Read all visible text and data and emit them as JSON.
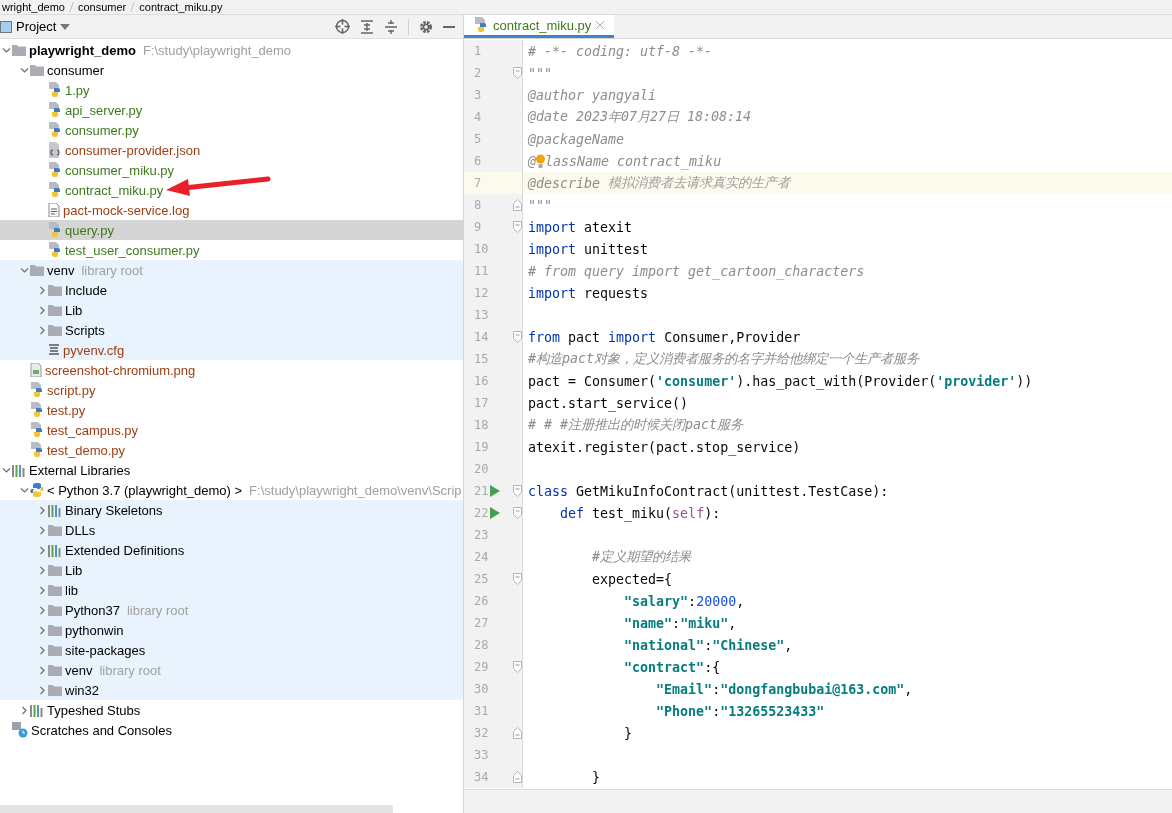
{
  "breadcrumb": [
    "wright_demo",
    "consumer",
    "contract_miku.py"
  ],
  "project_panel": {
    "title": "Project",
    "tree": [
      {
        "label": "playwright_demo",
        "hint": "F:\\study\\playwright_demo",
        "kind": "folder",
        "color": "#000000",
        "bold": true,
        "library": false,
        "selected": false,
        "expanded": true,
        "children": [
          {
            "label": "consumer",
            "kind": "folder",
            "color": "#000000",
            "library": false,
            "selected": false,
            "expanded": true,
            "children": [
              {
                "label": "1.py",
                "kind": "python-file",
                "color": "#3d7a1c",
                "library": false,
                "selected": false
              },
              {
                "label": "api_server.py",
                "kind": "python-file",
                "color": "#3d7a1c",
                "library": false,
                "selected": false
              },
              {
                "label": "consumer.py",
                "kind": "python-file",
                "color": "#3d7a1c",
                "library": false,
                "selected": false
              },
              {
                "label": "consumer-provider.json",
                "kind": "json-file",
                "color": "#9c3d12",
                "library": false,
                "selected": false
              },
              {
                "label": "consumer_miku.py",
                "kind": "python-file",
                "color": "#3d7a1c",
                "library": false,
                "selected": false
              },
              {
                "label": "contract_miku.py",
                "kind": "python-file",
                "color": "#3d7a1c",
                "library": false,
                "selected": false
              },
              {
                "label": "pact-mock-service.log",
                "kind": "text-file",
                "color": "#9c3d12",
                "library": false,
                "selected": false
              },
              {
                "label": "query.py",
                "kind": "python-file",
                "color": "#3d7a1c",
                "library": false,
                "selected": true
              },
              {
                "label": "test_user_consumer.py",
                "kind": "python-file",
                "color": "#3d7a1c",
                "library": false,
                "selected": false
              }
            ]
          },
          {
            "label": "venv",
            "hint": "library root",
            "kind": "folder",
            "color": "#000000",
            "library": true,
            "selected": false,
            "expanded": true,
            "children": [
              {
                "label": "Include",
                "kind": "folder",
                "color": "#000000",
                "library": true,
                "selected": false,
                "expanded": false
              },
              {
                "label": "Lib",
                "kind": "folder",
                "color": "#000000",
                "library": true,
                "selected": false,
                "expanded": false
              },
              {
                "label": "Scripts",
                "kind": "folder",
                "color": "#000000",
                "library": true,
                "selected": false,
                "expanded": false
              },
              {
                "label": "pyvenv.cfg",
                "kind": "config-file",
                "color": "#9c3d12",
                "library": true,
                "selected": false
              }
            ]
          },
          {
            "label": "screenshot-chromium.png",
            "kind": "image-file",
            "color": "#9c3d12",
            "library": false,
            "selected": false
          },
          {
            "label": "script.py",
            "kind": "python-file",
            "color": "#9c3d12",
            "library": false,
            "selected": false
          },
          {
            "label": "test.py",
            "kind": "python-file",
            "color": "#9c3d12",
            "library": false,
            "selected": false
          },
          {
            "label": "test_campus.py",
            "kind": "python-file",
            "color": "#9c3d12",
            "library": false,
            "selected": false
          },
          {
            "label": "test_demo.py",
            "kind": "python-file",
            "color": "#9c3d12",
            "library": false,
            "selected": false
          }
        ]
      },
      {
        "label": "External Libraries",
        "kind": "library",
        "color": "#000000",
        "library": false,
        "selected": false,
        "expanded": true,
        "children": [
          {
            "label": "< Python 3.7 (playwright_demo) >",
            "hint": "F:\\study\\playwright_demo\\venv\\Scrip",
            "kind": "python-sdk",
            "color": "#000000",
            "library": false,
            "selected": false,
            "expanded": true,
            "children": [
              {
                "label": "Binary Skeletons",
                "kind": "library",
                "color": "#000000",
                "library": true,
                "selected": false,
                "expanded": false
              },
              {
                "label": "DLLs",
                "kind": "folder",
                "color": "#000000",
                "library": true,
                "selected": false,
                "expanded": false
              },
              {
                "label": "Extended Definitions",
                "kind": "library",
                "color": "#000000",
                "library": true,
                "selected": false,
                "expanded": false
              },
              {
                "label": "Lib",
                "kind": "folder",
                "color": "#000000",
                "library": true,
                "selected": false,
                "expanded": false
              },
              {
                "label": "lib",
                "kind": "folder",
                "color": "#000000",
                "library": true,
                "selected": false,
                "expanded": false
              },
              {
                "label": "Python37",
                "hint": "library root",
                "kind": "folder",
                "color": "#000000",
                "library": true,
                "selected": false,
                "expanded": false
              },
              {
                "label": "pythonwin",
                "kind": "folder",
                "color": "#000000",
                "library": true,
                "selected": false,
                "expanded": false
              },
              {
                "label": "site-packages",
                "kind": "folder",
                "color": "#000000",
                "library": true,
                "selected": false,
                "expanded": false
              },
              {
                "label": "venv",
                "hint": "library root",
                "kind": "folder",
                "color": "#000000",
                "library": true,
                "selected": false,
                "expanded": false
              },
              {
                "label": "win32",
                "kind": "folder",
                "color": "#000000",
                "library": true,
                "selected": false,
                "expanded": false
              }
            ]
          },
          {
            "label": "Typeshed Stubs",
            "kind": "library",
            "color": "#000000",
            "library": false,
            "selected": false,
            "expanded": false
          }
        ]
      },
      {
        "label": "Scratches and Consoles",
        "kind": "scratches",
        "color": "#000000",
        "library": false,
        "selected": false
      }
    ]
  },
  "editor": {
    "tabs": [
      {
        "label": "contract_miku.py",
        "selected": true
      }
    ],
    "lines": [
      {
        "number": "1",
        "tokens": [
          {
            "kind": "comment",
            "text": "# -*- coding: utf-8 -*-"
          }
        ]
      },
      {
        "number": "2",
        "fold_start": true,
        "tokens": [
          {
            "kind": "doc",
            "text": "\"\"\""
          }
        ]
      },
      {
        "number": "3",
        "tokens": [
          {
            "kind": "doc",
            "text": "@author yangyali"
          }
        ]
      },
      {
        "number": "4",
        "tokens": [
          {
            "kind": "doc",
            "text": "@date 2023年07月27日 18:08:14"
          }
        ]
      },
      {
        "number": "5",
        "tokens": [
          {
            "kind": "doc",
            "text": "@packageName"
          }
        ]
      },
      {
        "number": "6",
        "tokens": [
          {
            "kind": "doc",
            "text": "@"
          },
          {
            "kind": "bulb"
          },
          {
            "kind": "doc",
            "text": "lassName contract_miku"
          }
        ]
      },
      {
        "number": "7",
        "current": true,
        "tokens": [
          {
            "kind": "doc",
            "text": "@describe "
          },
          {
            "kind": "doc-note",
            "text": "模拟消费者去请求真实的生产者"
          }
        ]
      },
      {
        "number": "8",
        "fold_end": true,
        "tokens": [
          {
            "kind": "doc",
            "text": "\"\"\""
          }
        ]
      },
      {
        "number": "9",
        "fold_start": true,
        "tokens": [
          {
            "kind": "keyword",
            "text": "import"
          },
          {
            "kind": "plain",
            "text": " atexit"
          }
        ]
      },
      {
        "number": "10",
        "tokens": [
          {
            "kind": "keyword",
            "text": "import"
          },
          {
            "kind": "plain",
            "text": " unittest"
          }
        ]
      },
      {
        "number": "11",
        "tokens": [
          {
            "kind": "comment",
            "text": "# from query import get_cartoon_characters"
          }
        ]
      },
      {
        "number": "12",
        "tokens": [
          {
            "kind": "keyword",
            "text": "import"
          },
          {
            "kind": "plain",
            "text": " requests"
          }
        ]
      },
      {
        "number": "13"
      },
      {
        "number": "14",
        "fold_start": true,
        "tokens": [
          {
            "kind": "keyword",
            "text": "from"
          },
          {
            "kind": "plain",
            "text": " pact "
          },
          {
            "kind": "keyword",
            "text": "import"
          },
          {
            "kind": "plain",
            "text": " Consumer,Provider"
          }
        ]
      },
      {
        "number": "15",
        "tokens": [
          {
            "kind": "comment",
            "text": "#构造pact对象，定义消费者服务的名字并给他绑定一个生产者服务"
          }
        ]
      },
      {
        "number": "16",
        "tokens": [
          {
            "kind": "plain",
            "text": "pact = Consumer("
          },
          {
            "kind": "string",
            "text": "'consumer'"
          },
          {
            "kind": "plain",
            "text": ").has_pact_with(Provider("
          },
          {
            "kind": "string",
            "text": "'provider'"
          },
          {
            "kind": "plain",
            "text": "))"
          }
        ]
      },
      {
        "number": "17",
        "tokens": [
          {
            "kind": "plain",
            "text": "pact.start_service()"
          }
        ]
      },
      {
        "number": "18",
        "tokens": [
          {
            "kind": "comment",
            "text": "# # #注册推出的时候关闭pact服务"
          }
        ]
      },
      {
        "number": "19",
        "tokens": [
          {
            "kind": "plain",
            "text": "atexit.register(pact.stop_service)"
          }
        ]
      },
      {
        "number": "20"
      },
      {
        "number": "21",
        "run": true,
        "fold_start": true,
        "tokens": [
          {
            "kind": "keyword",
            "text": "class"
          },
          {
            "kind": "plain",
            "text": " GetMikuInfoContract(unittest.TestCase):"
          }
        ]
      },
      {
        "number": "22",
        "run": true,
        "fold_start": true,
        "tokens": [
          {
            "kind": "keyword",
            "text": "    def"
          },
          {
            "kind": "plain",
            "text": " test_miku("
          },
          {
            "kind": "self",
            "text": "self"
          },
          {
            "kind": "plain",
            "text": "):"
          }
        ]
      },
      {
        "number": "23"
      },
      {
        "number": "24",
        "tokens": [
          {
            "kind": "comment",
            "text": "        #定义期望的结果"
          }
        ]
      },
      {
        "number": "25",
        "fold_start": true,
        "tokens": [
          {
            "kind": "plain",
            "text": "        expected={"
          }
        ]
      },
      {
        "number": "26",
        "tokens": [
          {
            "kind": "string",
            "text": "            \"salary\""
          },
          {
            "kind": "plain",
            "text": ":"
          },
          {
            "kind": "number",
            "text": "20000"
          },
          {
            "kind": "plain",
            "text": ","
          }
        ]
      },
      {
        "number": "27",
        "tokens": [
          {
            "kind": "string",
            "text": "            \"name\""
          },
          {
            "kind": "plain",
            "text": ":"
          },
          {
            "kind": "string",
            "text": "\"miku\""
          },
          {
            "kind": "plain",
            "text": ","
          }
        ]
      },
      {
        "number": "28",
        "tokens": [
          {
            "kind": "string",
            "text": "            \"national\""
          },
          {
            "kind": "plain",
            "text": ":"
          },
          {
            "kind": "string",
            "text": "\"Chinese\""
          },
          {
            "kind": "plain",
            "text": ","
          }
        ]
      },
      {
        "number": "29",
        "fold_start": true,
        "tokens": [
          {
            "kind": "string",
            "text": "            \"contract\""
          },
          {
            "kind": "plain",
            "text": ":{"
          }
        ]
      },
      {
        "number": "30",
        "tokens": [
          {
            "kind": "string",
            "text": "                \"Email\""
          },
          {
            "kind": "plain",
            "text": ":"
          },
          {
            "kind": "string",
            "text": "\"dongfangbubai@163.com\""
          },
          {
            "kind": "plain",
            "text": ","
          }
        ]
      },
      {
        "number": "31",
        "tokens": [
          {
            "kind": "string",
            "text": "                \"Phone\""
          },
          {
            "kind": "plain",
            "text": ":"
          },
          {
            "kind": "string",
            "text": "\"13265523433\""
          }
        ]
      },
      {
        "number": "32",
        "fold_end": true,
        "tokens": [
          {
            "kind": "plain",
            "text": "            }"
          }
        ]
      },
      {
        "number": "33"
      },
      {
        "number": "34",
        "fold_end": true,
        "tokens": [
          {
            "kind": "plain",
            "text": "        }"
          }
        ]
      }
    ]
  }
}
